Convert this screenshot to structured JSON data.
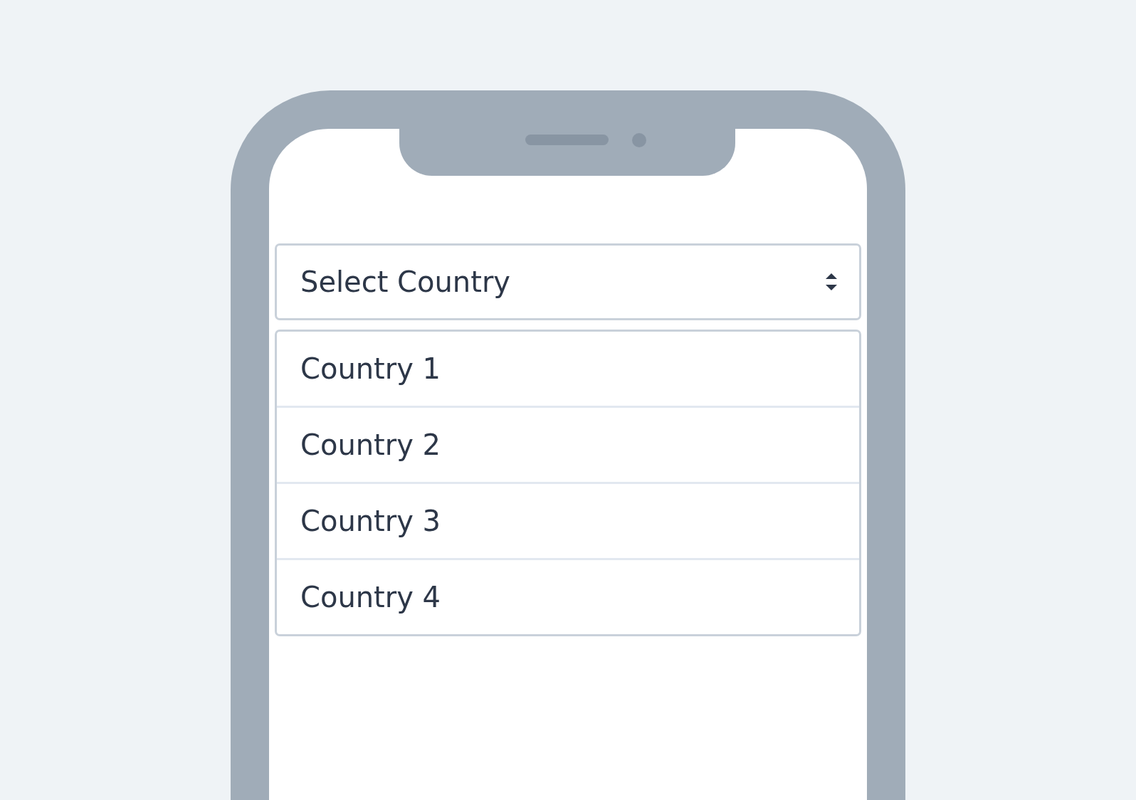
{
  "select": {
    "label": "Select Country"
  },
  "options": [
    {
      "label": "Country 1",
      "selected": false
    },
    {
      "label": "Country 2",
      "selected": false
    },
    {
      "label": "Country 3",
      "selected": false
    },
    {
      "label": "Country 4",
      "selected": false
    }
  ]
}
